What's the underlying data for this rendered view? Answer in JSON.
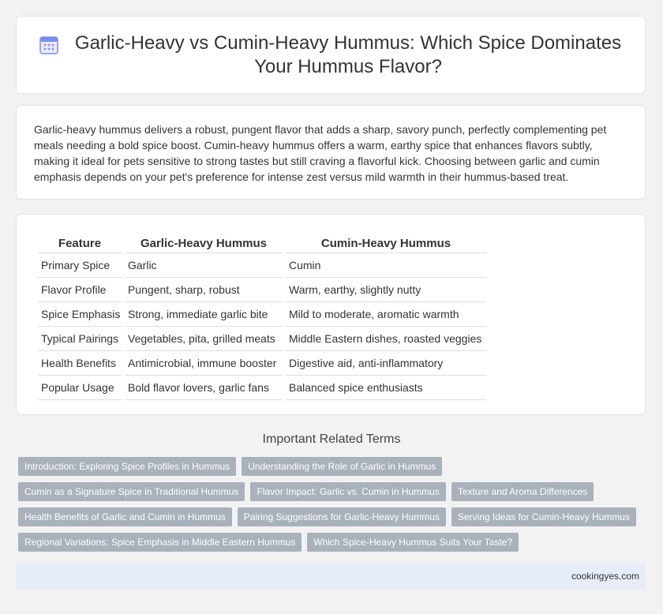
{
  "header": {
    "title": "Garlic-Heavy vs Cumin-Heavy Hummus: Which Spice Dominates Your Hummus Flavor?",
    "icon": "calendar-icon",
    "icon_color": "#7b8cf0"
  },
  "summary": {
    "text": "Garlic-heavy hummus delivers a robust, pungent flavor that adds a sharp, savory punch, perfectly complementing pet meals needing a bold spice boost. Cumin-heavy hummus offers a warm, earthy spice that enhances flavors subtly, making it ideal for pets sensitive to strong tastes but still craving a flavorful kick. Choosing between garlic and cumin emphasis depends on your pet's preference for intense zest versus mild warmth in their hummus-based treat."
  },
  "table": {
    "headers": [
      "Feature",
      "Garlic-Heavy Hummus",
      "Cumin-Heavy Hummus"
    ],
    "rows": [
      [
        "Primary Spice",
        "Garlic",
        "Cumin"
      ],
      [
        "Flavor Profile",
        "Pungent, sharp, robust",
        "Warm, earthy, slightly nutty"
      ],
      [
        "Spice Emphasis",
        "Strong, immediate garlic bite",
        "Mild to moderate, aromatic warmth"
      ],
      [
        "Typical Pairings",
        "Vegetables, pita, grilled meats",
        "Middle Eastern dishes, roasted veggies"
      ],
      [
        "Health Benefits",
        "Antimicrobial, immune booster",
        "Digestive aid, anti-inflammatory"
      ],
      [
        "Popular Usage",
        "Bold flavor lovers, garlic fans",
        "Balanced spice enthusiasts"
      ]
    ]
  },
  "related": {
    "title": "Important Related Terms",
    "tag_color": "#a9b1bb",
    "rows": [
      [
        "Introduction: Exploring Spice Profiles in Hummus",
        "Understanding the Role of Garlic in Hummus"
      ],
      [
        "Cumin as a Signature Spice in Traditional Hummus",
        "Flavor Impact: Garlic vs. Cumin in Hummus",
        "Texture and Aroma Differences"
      ],
      [
        "Health Benefits of Garlic and Cumin in Hummus",
        "Pairing Suggestions for Garlic-Heavy Hummus",
        "Serving Ideas for Cumin-Heavy Hummus"
      ],
      [
        "Regional Variations: Spice Emphasis in Middle Eastern Hummus",
        "Which Spice-Heavy Hummus Suits Your Taste?"
      ]
    ]
  },
  "footer": {
    "site": "cookingyes.com",
    "background": "#e7edf8"
  }
}
